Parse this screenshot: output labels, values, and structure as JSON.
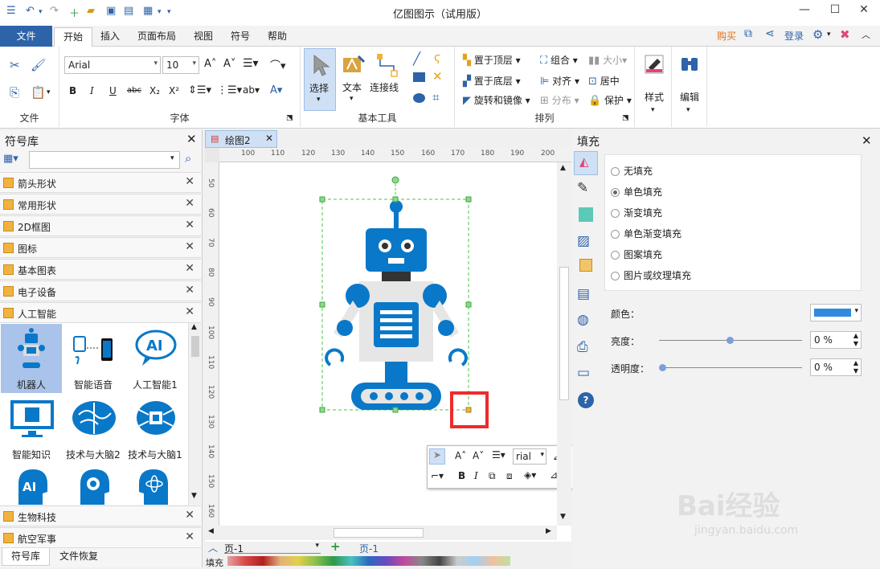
{
  "window": {
    "title": "亿图图示（试用版）"
  },
  "tabs": {
    "file": "文件",
    "items": [
      "开始",
      "插入",
      "页面布局",
      "视图",
      "符号",
      "帮助"
    ]
  },
  "topright": {
    "buy": "购买",
    "login": "登录"
  },
  "ribbon": {
    "groups": {
      "file": "文件",
      "font": "字体",
      "basic_tools": "基本工具",
      "arrange": "排列"
    },
    "font_name": "Arial",
    "font_size": "10",
    "tools": {
      "select": "选择",
      "text": "文本",
      "connector": "连接线"
    },
    "arrange": {
      "bring_front": "置于顶层",
      "send_back": "置于底层",
      "rotate_mirror": "旋转和镜像",
      "group": "组合",
      "align": "对齐",
      "distribute": "分布",
      "size": "大小",
      "center": "居中",
      "protect": "保护"
    },
    "style": "样式",
    "edit": "编辑"
  },
  "library": {
    "title": "符号库",
    "search_placeholder": "",
    "categories": [
      "箭头形状",
      "常用形状",
      "2D框图",
      "图标",
      "基本图表",
      "电子设备",
      "人工智能"
    ],
    "symbols": [
      "机器人",
      "智能语音",
      "人工智能1",
      "智能知识",
      "技术与大脑2",
      "技术与大脑1"
    ],
    "ai_label": "AI",
    "bottom_categories": [
      "生物科技",
      "航空军事"
    ],
    "bottom_tabs": [
      "符号库",
      "文件恢复"
    ]
  },
  "document": {
    "tab": "绘图2",
    "ruler_h": [
      "100",
      "110",
      "120",
      "130",
      "140",
      "150",
      "160",
      "170",
      "180",
      "190",
      "200"
    ],
    "ruler_v": [
      "50",
      "60",
      "70",
      "80",
      "90",
      "100",
      "110",
      "120",
      "130",
      "140",
      "150",
      "160"
    ],
    "page_selector": "页-1",
    "page_tab": "页-1"
  },
  "minitoolbar": {
    "font": "rial"
  },
  "fill_panel": {
    "title": "填充",
    "options": [
      "无填充",
      "单色填充",
      "渐变填充",
      "单色渐变填充",
      "图案填充",
      "图片或纹理填充"
    ],
    "selected": "单色填充",
    "color_label": "颜色：",
    "brightness_label": "亮度：",
    "brightness_value": "0 %",
    "transparency_label": "透明度：",
    "transparency_value": "0 %",
    "color": "#2f8ae0"
  },
  "statusbar": {
    "fill": "填充"
  },
  "watermark": {
    "main": "Bai经验",
    "sub": "jingyan.baidu.com"
  }
}
